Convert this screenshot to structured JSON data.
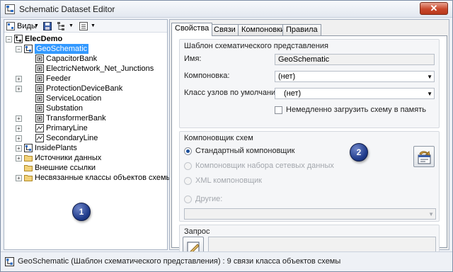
{
  "window": {
    "title": "Schematic Dataset Editor",
    "close_glyph": "✕"
  },
  "left": {
    "toolbar": {
      "views_label": "Виды",
      "icons": [
        "views-icon",
        "save-icon",
        "tree-options-icon",
        "list-options-icon"
      ]
    },
    "tree": {
      "root": "ElecDemo",
      "geo": "GeoSchematic",
      "children": [
        "CapacitorBank",
        "ElectricNetwork_Net_Junctions",
        "Feeder",
        "ProtectionDeviceBank",
        "ServiceLocation",
        "Substation",
        "TransformerBank",
        "PrimaryLine",
        "SecondaryLine"
      ],
      "inside_plants": "InsidePlants",
      "data_sources": "Источники данных",
      "external_links": "Внешние ссылки",
      "unassociated": "Несвязанные классы объектов схемы"
    }
  },
  "right": {
    "tabs": [
      "Свойства",
      "Связи",
      "Компоновки",
      "Правила"
    ],
    "template_group": {
      "title": "Шаблон схематического представления",
      "name_label": "Имя:",
      "name_value": "GeoSchematic",
      "layout_label": "Компоновка:",
      "layout_value": "(нет)",
      "default_class_label": "Класс узлов по умолчанию:",
      "default_class_value": "(нет)",
      "load_memory_label": "Немедленно загрузить схему в память"
    },
    "builder_group": {
      "title": "Компоновщик схем",
      "standard": "Стандартный компоновщик",
      "network": "Компоновщик набора сетевых данных",
      "xml": "XML  компоновщик",
      "other": "Другие:"
    },
    "query_group": {
      "title": "Запрос"
    }
  },
  "callouts": {
    "one": "1",
    "two": "2"
  },
  "status": {
    "text": "GeoSchematic (Шаблон схематического представления) : 9 связи класса объектов схемы"
  }
}
